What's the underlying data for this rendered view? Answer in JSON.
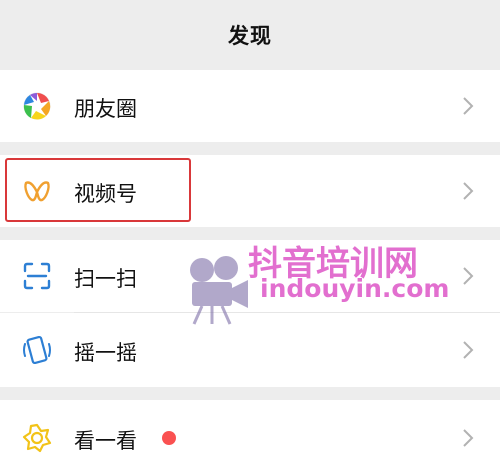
{
  "header": {
    "title": "发现"
  },
  "items": [
    {
      "label": "朋友圈",
      "icon": "moments-aperture-icon"
    },
    {
      "label": "视频号",
      "icon": "channels-icon",
      "color": "#f0a030"
    },
    {
      "label": "扫一扫",
      "icon": "scan-icon",
      "color": "#2d7fd4"
    },
    {
      "label": "摇一摇",
      "icon": "shake-icon",
      "color": "#2d7fd4"
    },
    {
      "label": "看一看",
      "icon": "top-stories-icon",
      "color": "#f2c318",
      "badge_color": "#fa5151"
    }
  ],
  "watermark": {
    "title": "抖音培训网",
    "site": "indouyin.com"
  }
}
